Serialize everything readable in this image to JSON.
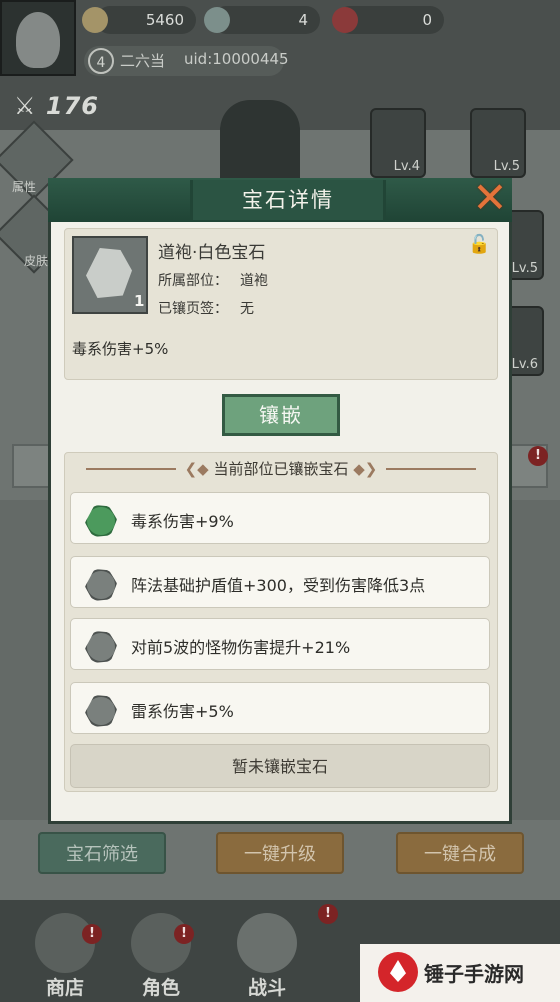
{
  "top_bar": {
    "coins": "5460",
    "gems": "4",
    "orbs": "0",
    "player_level": "4",
    "player_name": "二六当",
    "uid": "uid:10000445",
    "power": "176"
  },
  "side_buttons": [
    "属性",
    "皮肤"
  ],
  "equipment": [
    {
      "label": "Lv.4"
    },
    {
      "label": "Lv.5"
    },
    {
      "label": "Lv.5"
    },
    {
      "label": "Lv.6"
    }
  ],
  "modal": {
    "title": "宝石详情",
    "gem": {
      "name": "道袍·白色宝石",
      "count": "1",
      "part_label": "所属部位：",
      "part_value": "道袍",
      "page_label": "已镶页签：",
      "page_value": "无",
      "effect": "毒系伤害+5%"
    },
    "inlay_label": "镶嵌",
    "section_title": "当前部位已镶嵌宝石",
    "inlaid": [
      {
        "text": "毒系伤害+9%",
        "color": "green"
      },
      {
        "text": "阵法基础护盾值+300，受到伤害降低3点",
        "color": "grey"
      },
      {
        "text": "对前5波的怪物伤害提升+21%",
        "color": "grey"
      },
      {
        "text": "雷系伤害+5%",
        "color": "grey"
      }
    ],
    "empty_slot": "暂未镶嵌宝石"
  },
  "bottom_buttons": {
    "filter": "宝石筛选",
    "upgrade": "一键升级",
    "merge": "一键合成"
  },
  "nav": {
    "shop": "商店",
    "role": "角色",
    "battle": "战斗",
    "badge": "!"
  },
  "watermark": "锤子手游网",
  "colors": {
    "modal_header": "#2b5443",
    "inlay_button": "#6ea27d",
    "close_x": "#e3733a"
  }
}
